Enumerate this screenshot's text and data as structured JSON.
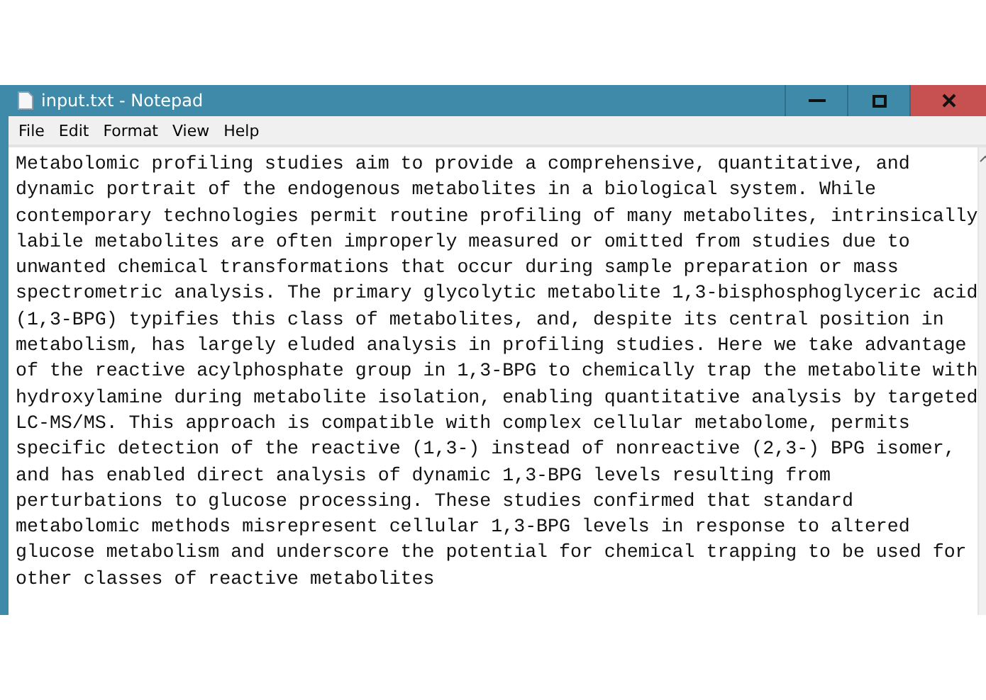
{
  "window": {
    "title": "input.txt - Notepad"
  },
  "menu": [
    "File",
    "Edit",
    "Format",
    "View",
    "Help"
  ],
  "lines": [
    "Metabolomic profiling studies aim to provide a comprehensive, quantitative, and",
    "dynamic portrait of the endogenous metabolites in a biological system. While",
    "contemporary technologies permit routine profiling of many metabolites, intrinsically",
    "labile metabolites are often improperly measured or omitted from studies due to",
    "unwanted chemical transformations that occur during sample preparation or mass",
    "spectrometric analysis. The primary glycolytic metabolite 1,3-bisphosphoglyceric acid",
    "(1,3-BPG) typifies this class of metabolites, and, despite its central position in",
    "metabolism, has largely eluded analysis in profiling studies. Here we take advantage",
    "of the reactive acylphosphate group in 1,3-BPG to chemically trap the metabolite with",
    "hydroxylamine during metabolite isolation, enabling quantitative analysis by targeted",
    "LC-MS/MS. This approach is compatible with complex cellular metabolome, permits",
    "specific detection of the reactive (1,3-) instead of nonreactive (2,3-) BPG isomer,",
    "and has enabled direct analysis of dynamic 1,3-BPG levels resulting from",
    "perturbations to glucose processing. These studies confirmed that standard",
    "metabolomic methods misrepresent cellular 1,3-BPG levels in response to altered",
    "glucose metabolism and underscore the potential for chemical trapping to be used for",
    "other classes of reactive metabolites"
  ]
}
